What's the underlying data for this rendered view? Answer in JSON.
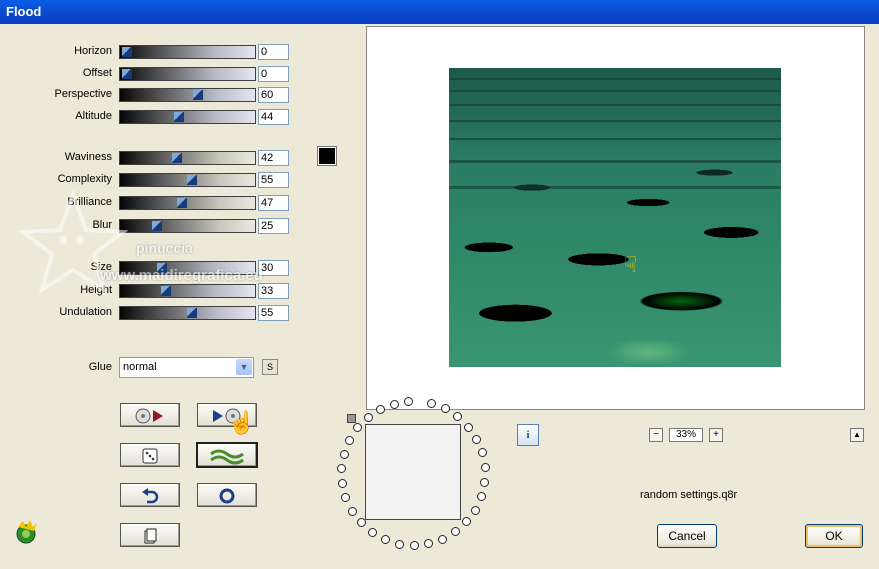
{
  "window": {
    "title": "Flood"
  },
  "sliders": [
    {
      "label": "Horizon",
      "value": "0",
      "pos": 0
    },
    {
      "label": "Offset",
      "value": "0",
      "pos": 0
    },
    {
      "label": "Perspective",
      "value": "60",
      "pos": 0.6
    },
    {
      "label": "Altitude",
      "value": "44",
      "pos": 0.44
    },
    {
      "label": "Waviness",
      "value": "42",
      "pos": 0.42
    },
    {
      "label": "Complexity",
      "value": "55",
      "pos": 0.55
    },
    {
      "label": "Brilliance",
      "value": "47",
      "pos": 0.47
    },
    {
      "label": "Blur",
      "value": "25",
      "pos": 0.25
    },
    {
      "label": "Size",
      "value": "30",
      "pos": 0.3
    },
    {
      "label": "Height",
      "value": "33",
      "pos": 0.33
    },
    {
      "label": "Undulation",
      "value": "55",
      "pos": 0.55
    }
  ],
  "color": {
    "swatch": "#000000"
  },
  "glue": {
    "label": "Glue",
    "value": "normal",
    "s_button": "S"
  },
  "icons": {
    "load_preset": "film-reel-play-icon",
    "save_preset": "play-film-reel-icon",
    "randomize": "dice-icon",
    "wave": "wave-icon",
    "undo": "undo-arrow-icon",
    "reset": "reset-circle-icon",
    "copy": "copy-document-icon",
    "info": "info-icon",
    "zoom_minus": "minus-icon",
    "zoom_plus": "plus-icon",
    "collapse": "caret-up-icon",
    "app_logo": "filter-logo-icon"
  },
  "zoom": {
    "minus": "−",
    "value": "33%",
    "plus": "+"
  },
  "info_label": "i",
  "collapse_label": "▲",
  "settings_file": "random settings.q8r",
  "buttons": {
    "cancel": "Cancel",
    "ok": "OK"
  },
  "watermark": {
    "line1": "pinuccia",
    "line2": "www.maidiregrafica.eu"
  }
}
